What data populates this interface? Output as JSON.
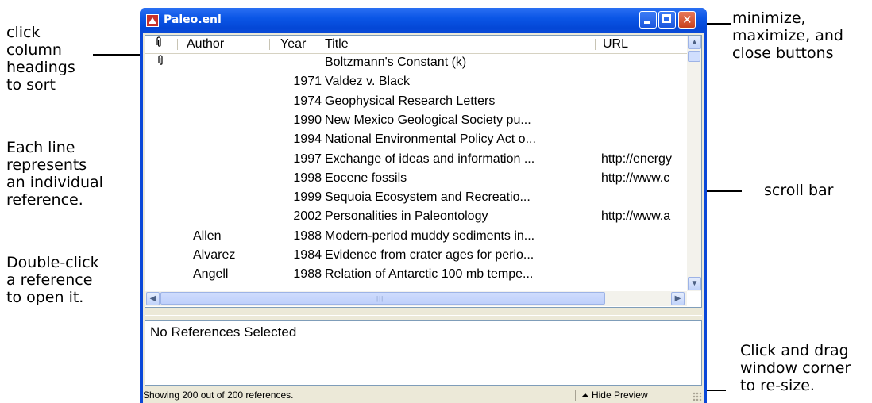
{
  "window": {
    "title": "Paleo.enl",
    "controls": {
      "minimize": "minimize",
      "maximize": "maximize",
      "close": "close"
    }
  },
  "columns": [
    "Author",
    "Year",
    "Title",
    "URL"
  ],
  "references": [
    {
      "clip": true,
      "author": "",
      "year": "",
      "title": "Boltzmann's Constant (k)",
      "url": ""
    },
    {
      "clip": false,
      "author": "",
      "year": "1971",
      "title": "Valdez v. Black",
      "url": ""
    },
    {
      "clip": false,
      "author": "",
      "year": "1974",
      "title": "Geophysical Research Letters",
      "url": ""
    },
    {
      "clip": false,
      "author": "",
      "year": "1990",
      "title": "New Mexico Geological Society pu...",
      "url": ""
    },
    {
      "clip": false,
      "author": "",
      "year": "1994",
      "title": "National Environmental Policy Act o...",
      "url": ""
    },
    {
      "clip": false,
      "author": "",
      "year": "1997",
      "title": "Exchange of ideas and information ...",
      "url": "http://energy"
    },
    {
      "clip": false,
      "author": "",
      "year": "1998",
      "title": "Eocene fossils",
      "url": "http://www.c"
    },
    {
      "clip": false,
      "author": "",
      "year": "1999",
      "title": "Sequoia Ecosystem and Recreatio...",
      "url": ""
    },
    {
      "clip": false,
      "author": "",
      "year": "2002",
      "title": "Personalities in Paleontology",
      "url": "http://www.a"
    },
    {
      "clip": false,
      "author": "Allen",
      "year": "1988",
      "title": "Modern-period muddy sediments in...",
      "url": ""
    },
    {
      "clip": false,
      "author": "Alvarez",
      "year": "1984",
      "title": "Evidence from crater ages for perio...",
      "url": ""
    },
    {
      "clip": false,
      "author": "Angell",
      "year": "1988",
      "title": "Relation of Antarctic 100 mb tempe...",
      "url": ""
    }
  ],
  "preview": {
    "text": "No References Selected"
  },
  "status": {
    "text": "Showing 200 out of 200 references.",
    "hide_preview": "Hide Preview"
  },
  "annotations": {
    "sort": "click\ncolumn\nheadings\nto sort",
    "each_line": "Each line\nrepresents\nan individual\nreference.",
    "double_click": "Double-click\na reference\nto open it.",
    "window_buttons": "minimize,\nmaximize, and\nclose buttons",
    "scroll_bar": "scroll bar",
    "resize": "Click and drag\nwindow corner\nto re-size."
  },
  "icons": {
    "app": "app-icon",
    "attachment": "paperclip-icon",
    "scroll_up": "scroll-up-arrow-icon",
    "scroll_down": "scroll-down-arrow-icon",
    "scroll_left": "scroll-left-arrow-icon",
    "scroll_right": "scroll-right-arrow-icon",
    "hide_preview": "eject-arrow-icon",
    "resize": "resize-grip-icon"
  },
  "colors": {
    "titlebar": "#0b56e6",
    "close_button": "#c8411d",
    "window_face": "#ece9d8"
  }
}
